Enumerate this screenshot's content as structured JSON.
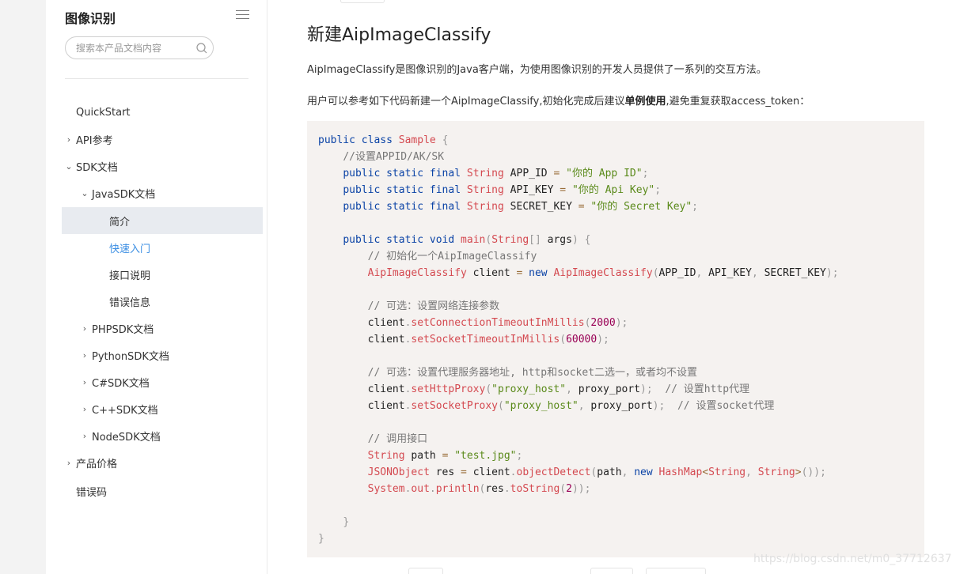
{
  "sidebar": {
    "title": "图像识别",
    "search_placeholder": "搜索本产品文档内容",
    "items": [
      {
        "label": "QuickStart",
        "chevron": "",
        "level": 0
      },
      {
        "label": "API参考",
        "chevron": "›",
        "level": 0
      },
      {
        "label": "SDK文档",
        "chevron": "⌄",
        "level": 0
      },
      {
        "label": "JavaSDK文档",
        "chevron": "⌄",
        "level": 1
      },
      {
        "label": "简介",
        "chevron": "",
        "level": 2
      },
      {
        "label": "快速入门",
        "chevron": "",
        "level": 2
      },
      {
        "label": "接口说明",
        "chevron": "",
        "level": 2
      },
      {
        "label": "错误信息",
        "chevron": "",
        "level": 2
      },
      {
        "label": "PHPSDK文档",
        "chevron": "›",
        "level": 1
      },
      {
        "label": "PythonSDK文档",
        "chevron": "›",
        "level": 1
      },
      {
        "label": "C#SDK文档",
        "chevron": "›",
        "level": 1
      },
      {
        "label": "C++SDK文档",
        "chevron": "›",
        "level": 1
      },
      {
        "label": "NodeSDK文档",
        "chevron": "›",
        "level": 1
      },
      {
        "label": "产品价格",
        "chevron": "›",
        "level": 0
      },
      {
        "label": "错误码",
        "chevron": "",
        "level": 0
      }
    ],
    "active_item": "简介",
    "link_item": "快速入门"
  },
  "main": {
    "heading": "新建AipImageClassify",
    "para1": "AipImageClassify是图像识别的Java客户端，为使用图像识别的开发人员提供了一系列的交互方法。",
    "para2_before": "用户可以参考如下代码新建一个AipImageClassify,初始化完成后建议",
    "para2_bold": "单例使用",
    "para2_after": ",避免重复获取access_token：",
    "code_lines": [
      "public class Sample {",
      "    //设置APPID/AK/SK",
      "    public static final String APP_ID = \"你的 App ID\";",
      "    public static final String API_KEY = \"你的 Api Key\";",
      "    public static final String SECRET_KEY = \"你的 Secret Key\";",
      "",
      "    public static void main(String[] args) {",
      "        // 初始化一个AipImageClassify",
      "        AipImageClassify client = new AipImageClassify(APP_ID, API_KEY, SECRET_KEY);",
      "",
      "        // 可选：设置网络连接参数",
      "        client.setConnectionTimeoutInMillis(2000);",
      "        client.setSocketTimeoutInMillis(60000);",
      "",
      "        // 可选：设置代理服务器地址, http和socket二选一，或者均不设置",
      "        client.setHttpProxy(\"proxy_host\", proxy_port);  // 设置http代理",
      "        client.setSocketProxy(\"proxy_host\", proxy_port);  // 设置socket代理",
      "",
      "        // 调用接口",
      "        String path = \"test.jpg\";",
      "        JSONObject res = client.objectDetect(path, new HashMap<String, String>());",
      "        System.out.println(res.toString(2));",
      "",
      "    }",
      "}"
    ]
  },
  "watermark": "https://blog.csdn.net/m0_37712637",
  "colors": {
    "active_bg": "#e8ebf0",
    "link": "#3b8ee3",
    "code_bg": "#f5f2f0",
    "keyword": "#0b43a6",
    "type": "#d44950",
    "string": "#5a8a1a"
  }
}
